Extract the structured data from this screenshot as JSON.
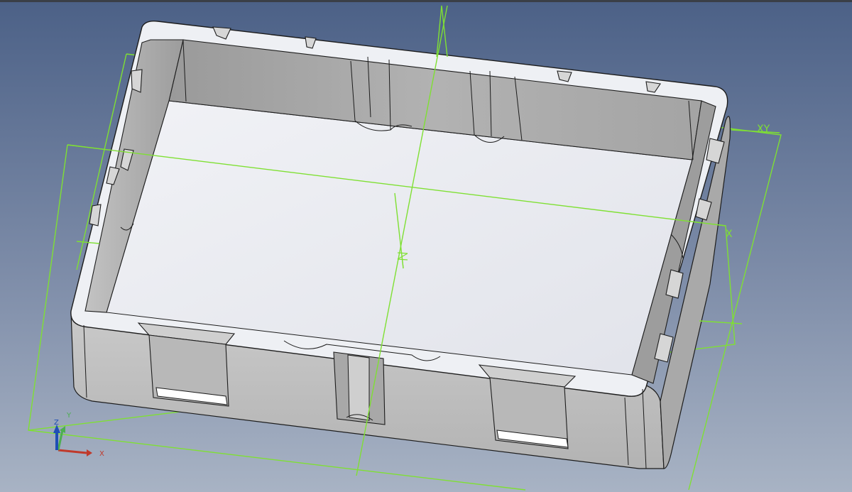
{
  "viewport": {
    "background_top": "#4e6388",
    "background_bottom": "#a6b2c4",
    "sketch_color": "#7fe033",
    "part_face_color": "#e8eaef",
    "part_wall_color": "#bdbdbd",
    "part_edge_color": "#1c1c1c"
  },
  "triad": {
    "x_label": "X",
    "y_label": "Y",
    "z_label": "Z",
    "x_color": "#c0392b",
    "y_color": "#4caf50",
    "z_color": "#1f4fb5"
  },
  "plane_labels": {
    "xy": "XY",
    "x": "X"
  }
}
